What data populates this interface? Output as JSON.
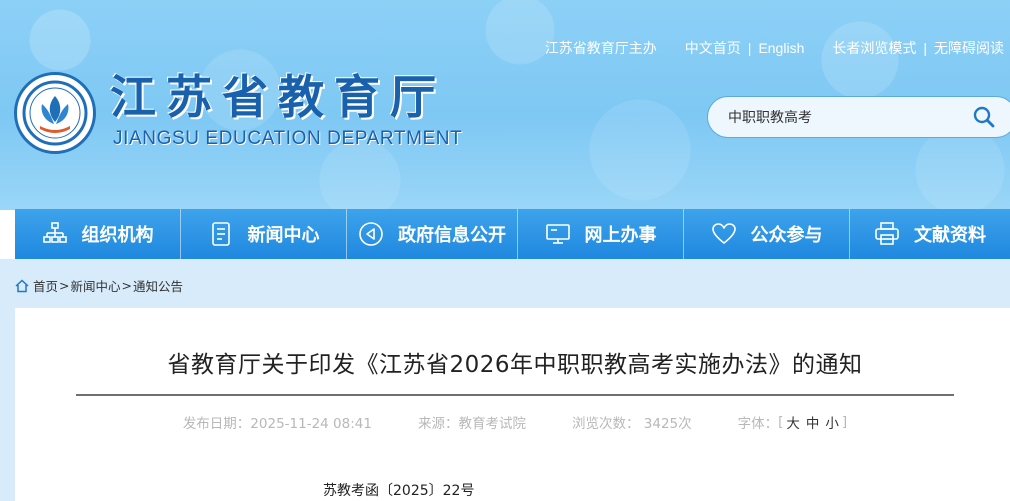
{
  "topbar": {
    "sponsor": "江苏省教育厅主办",
    "home": "中文首页",
    "english": "English",
    "elder_mode": "长者浏览模式",
    "accessible": "无障碍阅读"
  },
  "brand": {
    "title": "江苏省教育厅",
    "subtitle": "JIANGSU EDUCATION DEPARTMENT",
    "color": "#1960ad"
  },
  "search": {
    "value": "中职职教高考",
    "icon": "search-icon"
  },
  "nav": {
    "color": "#2a95e6",
    "items": [
      {
        "label": "组织机构",
        "icon": "org-chart-icon"
      },
      {
        "label": "新闻中心",
        "icon": "document-icon"
      },
      {
        "label": "政府信息公开",
        "icon": "megaphone-icon"
      },
      {
        "label": "网上办事",
        "icon": "monitor-icon"
      },
      {
        "label": "公众参与",
        "icon": "heart-icon"
      },
      {
        "label": "文献资料",
        "icon": "printer-icon"
      }
    ]
  },
  "breadcrumb": {
    "icon": "home-icon",
    "items": [
      "首页",
      "新闻中心",
      "通知公告"
    ],
    "separator": ">"
  },
  "article": {
    "title": "省教育厅关于印发《江苏省2026年中职职教高考实施办法》的通知",
    "published": "发布日期：2025-11-24 08:41",
    "source": "来源：教育考试院",
    "views": "浏览次数： 3425次",
    "font_label": "字体：",
    "font_open": "[",
    "font_large": "大",
    "font_medium": "中",
    "font_small": "小",
    "font_close": "]",
    "doc_number": "苏教考函〔2025〕22号"
  }
}
